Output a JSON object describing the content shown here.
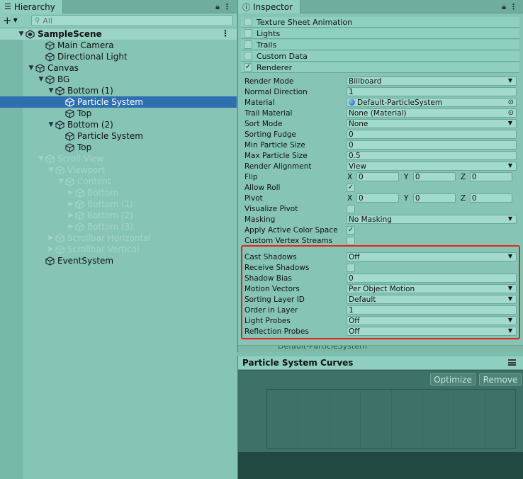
{
  "hierarchy": {
    "tab_label": "Hierarchy",
    "search_placeholder": "All",
    "rows": [
      {
        "label": "SampleScene",
        "indent": 0,
        "arrow": "▼",
        "icon": "unity-icon",
        "kind": "scene"
      },
      {
        "label": "Main Camera",
        "indent": 2,
        "arrow": "",
        "icon": "cube-icon",
        "kind": "normal"
      },
      {
        "label": "Directional Light",
        "indent": 2,
        "arrow": "",
        "icon": "cube-icon",
        "kind": "normal"
      },
      {
        "label": "Canvas",
        "indent": 1,
        "arrow": "▼",
        "icon": "cube-icon",
        "kind": "normal"
      },
      {
        "label": "BG",
        "indent": 2,
        "arrow": "▼",
        "icon": "cube-icon",
        "kind": "normal"
      },
      {
        "label": "Bottom (1)",
        "indent": 3,
        "arrow": "▼",
        "icon": "cube-icon",
        "kind": "normal"
      },
      {
        "label": "Particle System",
        "indent": 4,
        "arrow": "",
        "icon": "cube-icon",
        "kind": "selected"
      },
      {
        "label": "Top",
        "indent": 4,
        "arrow": "",
        "icon": "cube-icon",
        "kind": "normal"
      },
      {
        "label": "Bottom (2)",
        "indent": 3,
        "arrow": "▼",
        "icon": "cube-icon",
        "kind": "normal"
      },
      {
        "label": "Particle System",
        "indent": 4,
        "arrow": "",
        "icon": "cube-icon",
        "kind": "normal"
      },
      {
        "label": "Top",
        "indent": 4,
        "arrow": "",
        "icon": "cube-icon",
        "kind": "normal"
      },
      {
        "label": "Scroll View",
        "indent": 2,
        "arrow": "▼",
        "icon": "cube-icon",
        "kind": "dim"
      },
      {
        "label": "Viewport",
        "indent": 3,
        "arrow": "▼",
        "icon": "cube-icon",
        "kind": "dim"
      },
      {
        "label": "Content",
        "indent": 4,
        "arrow": "▼",
        "icon": "cube-icon",
        "kind": "dim"
      },
      {
        "label": "Bottom",
        "indent": 5,
        "arrow": "▶",
        "icon": "cube-icon",
        "kind": "dim"
      },
      {
        "label": "Bottom (1)",
        "indent": 5,
        "arrow": "▶",
        "icon": "cube-icon",
        "kind": "dim"
      },
      {
        "label": "Bottom (2)",
        "indent": 5,
        "arrow": "▶",
        "icon": "cube-icon",
        "kind": "dim"
      },
      {
        "label": "Bottom (3)",
        "indent": 5,
        "arrow": "▶",
        "icon": "cube-icon",
        "kind": "dim"
      },
      {
        "label": "Scrollbar Horizontal",
        "indent": 3,
        "arrow": "▶",
        "icon": "cube-icon",
        "kind": "dim"
      },
      {
        "label": "Scrollbar Vertical",
        "indent": 3,
        "arrow": "▶",
        "icon": "cube-icon",
        "kind": "dim"
      },
      {
        "label": "EventSystem",
        "indent": 2,
        "arrow": "",
        "icon": "cube-icon",
        "kind": "normal"
      }
    ]
  },
  "inspector": {
    "tab_label": "Inspector",
    "modules": [
      {
        "label": "Texture Sheet Animation",
        "checked": false
      },
      {
        "label": "Lights",
        "checked": false
      },
      {
        "label": "Trails",
        "checked": false
      },
      {
        "label": "Custom Data",
        "checked": false
      },
      {
        "label": "Renderer",
        "checked": true
      }
    ],
    "properties": [
      {
        "label": "Render Mode",
        "type": "dropdown",
        "value": "Billboard"
      },
      {
        "label": "Normal Direction",
        "type": "text",
        "value": "1"
      },
      {
        "label": "Material",
        "type": "object",
        "value": "Default-ParticleSystem",
        "has_icon": true
      },
      {
        "label": "Trail Material",
        "type": "object",
        "value": "None (Material)",
        "has_icon": false
      },
      {
        "label": "Sort Mode",
        "type": "dropdown",
        "value": "None"
      },
      {
        "label": "Sorting Fudge",
        "type": "text",
        "value": "0"
      },
      {
        "label": "Min Particle Size",
        "type": "text",
        "value": "0"
      },
      {
        "label": "Max Particle Size",
        "type": "text",
        "value": "0.5"
      },
      {
        "label": "Render Alignment",
        "type": "dropdown",
        "value": "View"
      },
      {
        "label": "Flip",
        "type": "vector",
        "axes": [
          "X",
          "Y",
          "Z"
        ],
        "values": [
          "0",
          "0",
          "0"
        ]
      },
      {
        "label": "Allow Roll",
        "type": "checkbox",
        "checked": true
      },
      {
        "label": "Pivot",
        "type": "vector",
        "axes": [
          "X",
          "Y",
          "Z"
        ],
        "values": [
          "0",
          "0",
          "0"
        ]
      },
      {
        "label": "Visualize Pivot",
        "type": "checkbox",
        "checked": false
      },
      {
        "label": "Masking",
        "type": "dropdown",
        "value": "No Masking"
      },
      {
        "label": "Apply Active Color Space",
        "type": "checkbox",
        "checked": true
      },
      {
        "label": "Custom Vertex Streams",
        "type": "checkbox",
        "checked": false
      },
      {
        "label": "Cast Shadows",
        "type": "dropdown",
        "value": "Off"
      },
      {
        "label": "Receive Shadows",
        "type": "checkbox",
        "checked": false
      },
      {
        "label": "Shadow Bias",
        "type": "text",
        "value": "0"
      },
      {
        "label": "Motion Vectors",
        "type": "dropdown",
        "value": "Per Object Motion"
      },
      {
        "label": "Sorting Layer ID",
        "type": "dropdown",
        "value": "Default"
      },
      {
        "label": "Order in Layer",
        "type": "text",
        "value": "1"
      },
      {
        "label": "Light Probes",
        "type": "dropdown",
        "value": "Off"
      },
      {
        "label": "Reflection Probes",
        "type": "dropdown",
        "value": "Off"
      }
    ],
    "next_component_label": "Default-ParticleSystem"
  },
  "curves": {
    "title": "Particle System Curves",
    "optimize_label": "Optimize",
    "remove_label": "Remove"
  },
  "colors": {
    "selection": "#2e6fb0",
    "highlight_box": "#e8231d",
    "panel_bg": "#86c5b6"
  }
}
